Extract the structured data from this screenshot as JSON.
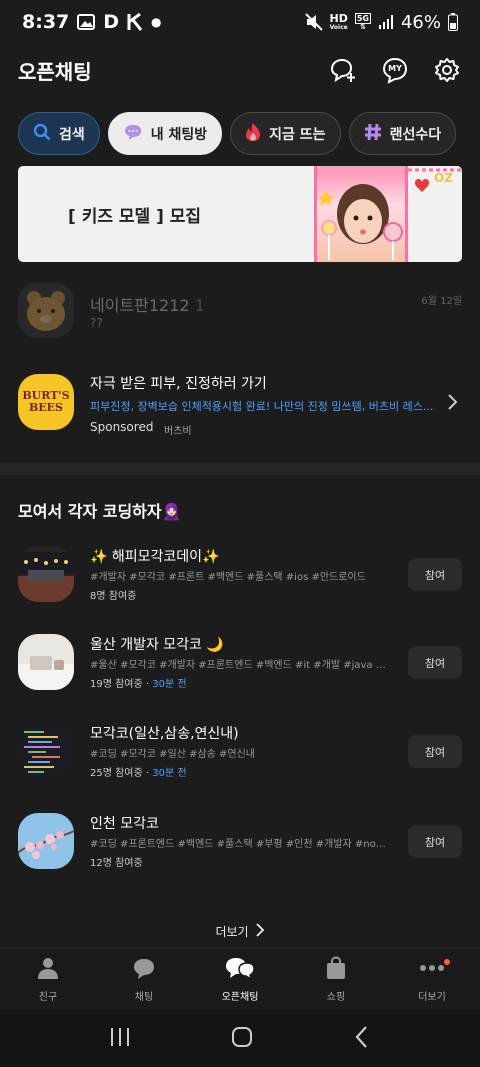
{
  "status_bar": {
    "time": "8:37",
    "battery": "46%",
    "hd_top": "HD",
    "hd_bottom": "Voice",
    "net": "5G"
  },
  "header": {
    "title": "오픈채팅"
  },
  "chips": [
    {
      "label": "검색",
      "icon": "search-icon"
    },
    {
      "label": "내 채팅방",
      "icon": "chat-bubble-icon"
    },
    {
      "label": "지금 뜨는",
      "icon": "fire-icon"
    },
    {
      "label": "랜선수다",
      "icon": "hashtag-icon"
    }
  ],
  "banner": {
    "text": "[ 키즈 모델 ] 모집"
  },
  "recent_chat": {
    "name": "네이트판1212",
    "count": "1",
    "preview": "??",
    "date": "6월 12일"
  },
  "ad": {
    "logo_line1": "BURT'S",
    "logo_line2": "BEES",
    "title": "자극 받은 피부, 진정하러 가기",
    "description": "피부진정, 장벽보습 인체적용시험 완료! 나만의 진정 밈쓰템, 버츠비 레스...",
    "sponsored": "Sponsored",
    "advertiser": "버츠비"
  },
  "section": {
    "title": "모여서 각자 코딩하자🧕🏻"
  },
  "rooms": [
    {
      "name": "✨ 해피모각코데이✨",
      "tags": "#개발자 #모각코 #프론트 #백엔드 #풀스택 #ios #안드로이드",
      "members": "8명 참여중",
      "ago": "",
      "join": "참여"
    },
    {
      "name": "울산 개발자 모각코 🌙",
      "tags": "#울산 #모각코 #개발자 #프론트엔드 #백엔드 #it #개발 #java #ja...",
      "members": "19명 참여중",
      "ago": "30분 전",
      "join": "참여"
    },
    {
      "name": "모각코(일산,삼송,연신내)",
      "tags": "#코딩 #모각코 #일산 #삼송 #연신내",
      "members": "25명 참여중",
      "ago": "30분 전",
      "join": "참여"
    },
    {
      "name": "인천 모각코",
      "tags": "#코딩 #프론트엔드 #백엔드 #풀스택 #부평 #인천 #개발자 #nods...",
      "members": "12명 참여중",
      "ago": "",
      "join": "참여"
    }
  ],
  "more": {
    "label": "더보기"
  },
  "tabs": [
    {
      "label": "친구",
      "icon": "person-icon"
    },
    {
      "label": "채팅",
      "icon": "chat-bubble-icon"
    },
    {
      "label": "오픈채팅",
      "icon": "open-chat-icon"
    },
    {
      "label": "쇼핑",
      "icon": "shopping-bag-icon"
    },
    {
      "label": "더보기",
      "icon": "more-dots-icon"
    }
  ],
  "header_icons": {
    "my_badge": "MY"
  }
}
